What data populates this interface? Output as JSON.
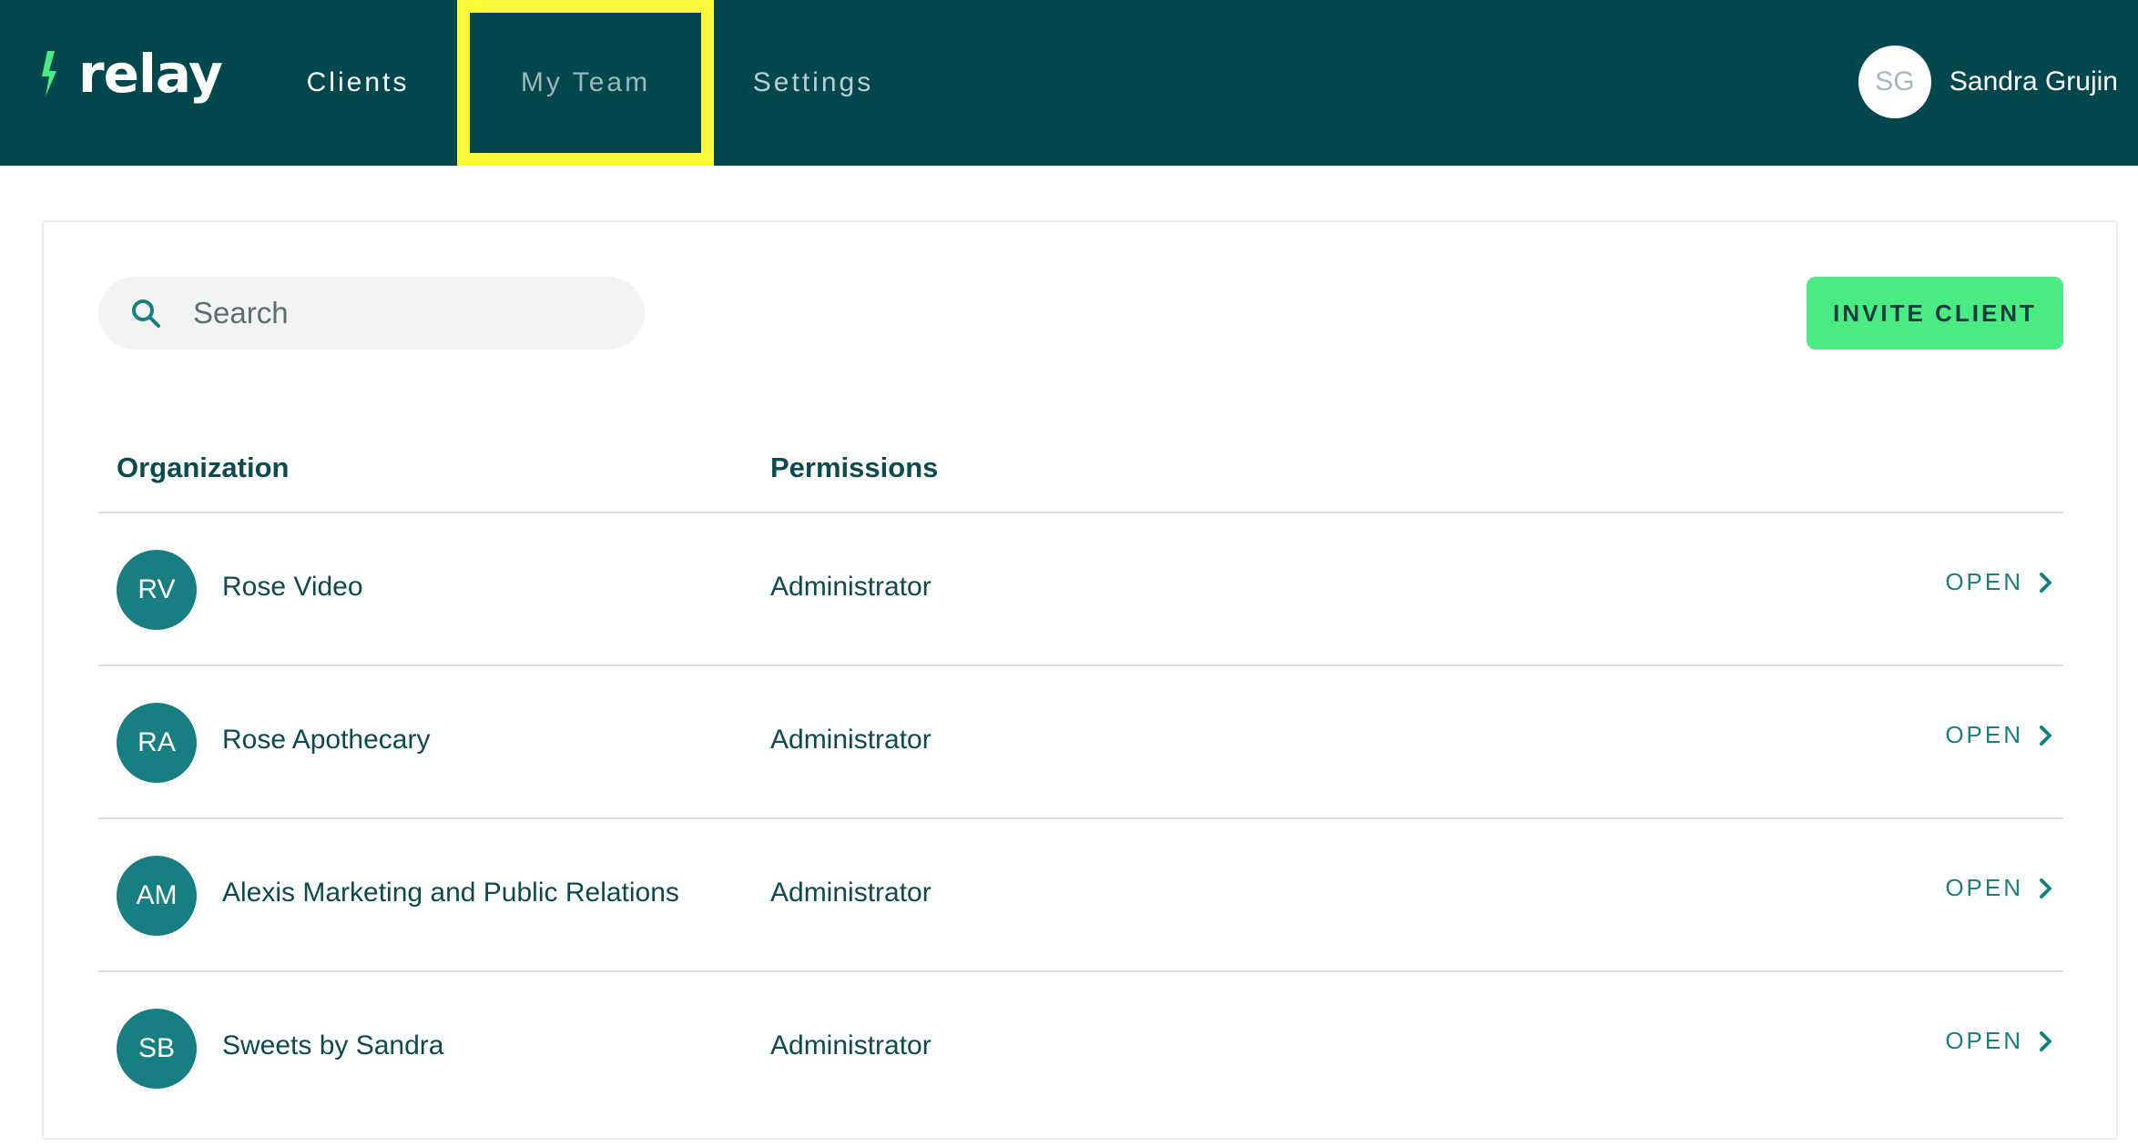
{
  "app": {
    "logo_text": "relay",
    "brand_color": "#4beb84",
    "header_color": "#02474d"
  },
  "nav": {
    "items": [
      {
        "label": "Clients"
      },
      {
        "label": "My Team"
      },
      {
        "label": "Settings"
      }
    ],
    "highlight_color": "#fbf93b"
  },
  "user": {
    "initials": "SG",
    "name": "Sandra Grujin"
  },
  "toolbar": {
    "search_placeholder": "Search",
    "search_value": "",
    "invite_label": "INVITE CLIENT"
  },
  "table": {
    "columns": [
      "Organization",
      "Permissions"
    ],
    "open_label": "OPEN",
    "rows": [
      {
        "initials": "RV",
        "name": "Rose Video",
        "permission": "Administrator"
      },
      {
        "initials": "RA",
        "name": "Rose Apothecary",
        "permission": "Administrator"
      },
      {
        "initials": "AM",
        "name": "Alexis Marketing and Public Relations",
        "permission": "Administrator"
      },
      {
        "initials": "SB",
        "name": "Sweets by Sandra",
        "permission": "Administrator"
      }
    ]
  },
  "icons": {
    "logo": "lightning-bolt-icon",
    "search": "search-icon",
    "open": "chevron-right-icon"
  }
}
